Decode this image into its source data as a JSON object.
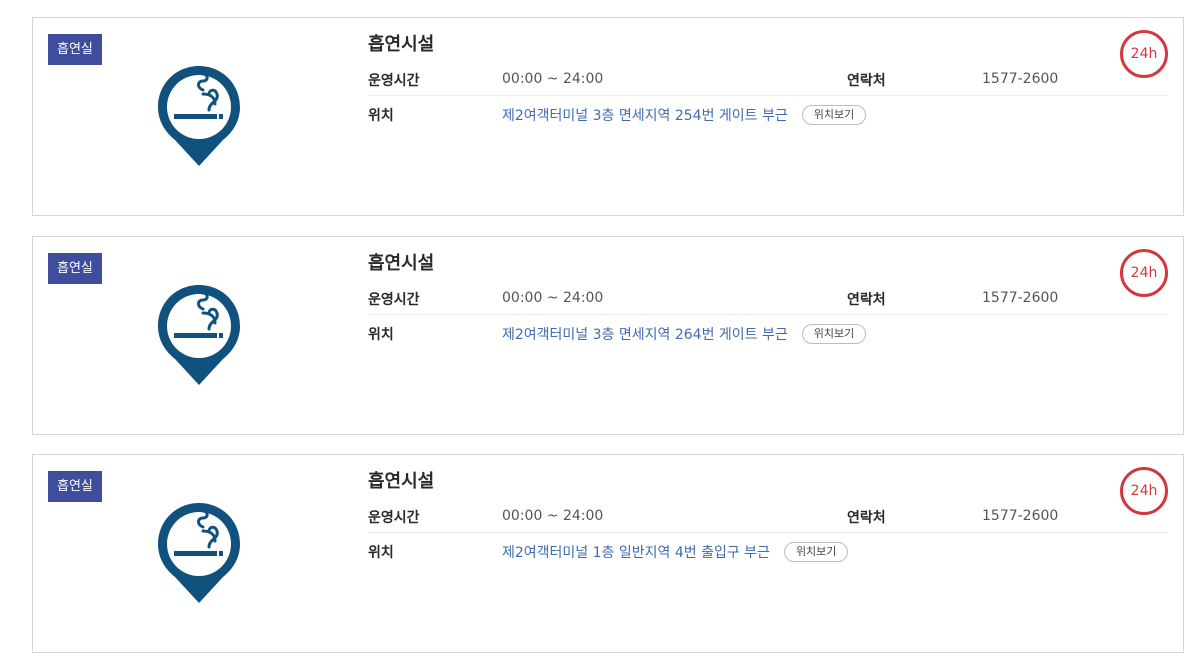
{
  "facilities": [
    {
      "badge": "흡연실",
      "icon": "smoking-area-pin-icon",
      "title": "흡연시설",
      "hours_label": "운영시간",
      "hours": "00:00 ~ 24:00",
      "contact_label": "연락처",
      "contact": "1577-2600",
      "location_label": "위치",
      "location": "제2여객터미널 3층 면세지역 254번 게이트 부근",
      "map_button": "위치보기",
      "open_badge": "24h"
    },
    {
      "badge": "흡연실",
      "icon": "smoking-area-pin-icon",
      "title": "흡연시설",
      "hours_label": "운영시간",
      "hours": "00:00 ~ 24:00",
      "contact_label": "연락처",
      "contact": "1577-2600",
      "location_label": "위치",
      "location": "제2여객터미널 3층 면세지역 264번 게이트 부근",
      "map_button": "위치보기",
      "open_badge": "24h"
    },
    {
      "badge": "흡연실",
      "icon": "smoking-area-pin-icon",
      "title": "흡연시설",
      "hours_label": "운영시간",
      "hours": "00:00 ~ 24:00",
      "contact_label": "연락처",
      "contact": "1577-2600",
      "location_label": "위치",
      "location": "제2여객터미널 1층 일반지역 4번 출입구 부근",
      "map_button": "위치보기",
      "open_badge": "24h"
    }
  ],
  "colors": {
    "badge_bg": "#3e4d9c",
    "pin": "#11517e",
    "link": "#3f6bb4",
    "open_badge": "#d2383f"
  }
}
